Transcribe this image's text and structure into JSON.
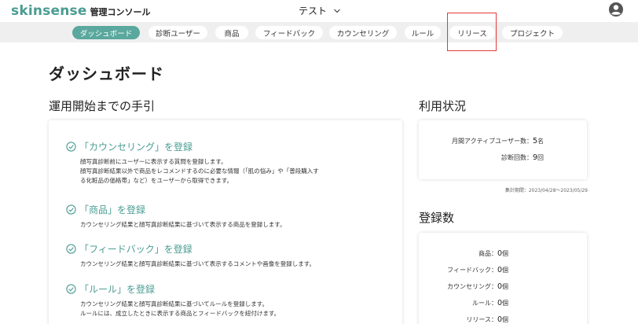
{
  "header": {
    "brand": "skinsense",
    "brand_sub": "管理コンソール",
    "project": "テスト"
  },
  "nav": {
    "tabs": [
      {
        "label": "ダッシュボード",
        "active": true
      },
      {
        "label": "診断ユーザー"
      },
      {
        "label": "商品"
      },
      {
        "label": "フィードバック"
      },
      {
        "label": "カウンセリング"
      },
      {
        "label": "ルール"
      },
      {
        "label": "リリース"
      },
      {
        "label": "プロジェクト"
      }
    ]
  },
  "main": {
    "title": "ダッシュボード",
    "guide": {
      "heading": "運用開始までの手引",
      "steps": [
        {
          "title": "「カウンセリング」を登録",
          "desc": [
            "顔写真診断前にユーザーに表示する質問を登録します。",
            "顔写真診断結果以外で商品をレコメンドするのに必要な情報（「肌の悩み」や「普段購入す",
            "る化粧品の価格帯」など）をユーザーから取得できます。"
          ]
        },
        {
          "title": "「商品」を登録",
          "desc": [
            "カウンセリング結果と顔写真診断結果に基づいて表示する商品を登録します。"
          ]
        },
        {
          "title": "「フィードバック」を登録",
          "desc": [
            "カウンセリング結果と顔写真診断結果に基づいて表示するコメントや画像を登録します。"
          ]
        },
        {
          "title": "「ルール」を登録",
          "desc": [
            "カウンセリング結果と顔写真診断結果に基づいてルールを登録します。",
            "ルールには、成立したときに表示する商品とフィードバックを紐付けます。"
          ]
        }
      ]
    },
    "usage": {
      "heading": "利用状況",
      "mau_label": "月間アクティブユーザー数：",
      "mau_value": "5",
      "mau_unit": "名",
      "diag_label": "診断回数：",
      "diag_value": "9",
      "diag_unit": "回",
      "period": "集計期間：2023/04/28〜2023/05/29"
    },
    "registrations": {
      "heading": "登録数",
      "rows": [
        {
          "label": "商品：",
          "value": "0",
          "unit": "個"
        },
        {
          "label": "フィードバック：",
          "value": "0",
          "unit": "個"
        },
        {
          "label": "カウンセリング：",
          "value": "0",
          "unit": "個"
        },
        {
          "label": "ルール：",
          "value": "0",
          "unit": "個"
        },
        {
          "label": "リリース：",
          "value": "0",
          "unit": "個"
        }
      ]
    }
  },
  "colors": {
    "accent": "#4a9c92",
    "active_tab": "#5aa89e",
    "highlight": "#e23a3a"
  },
  "icons": {
    "project_dropdown": "chevron-down-icon",
    "user": "user-account-icon",
    "step": "check-circle-icon"
  }
}
